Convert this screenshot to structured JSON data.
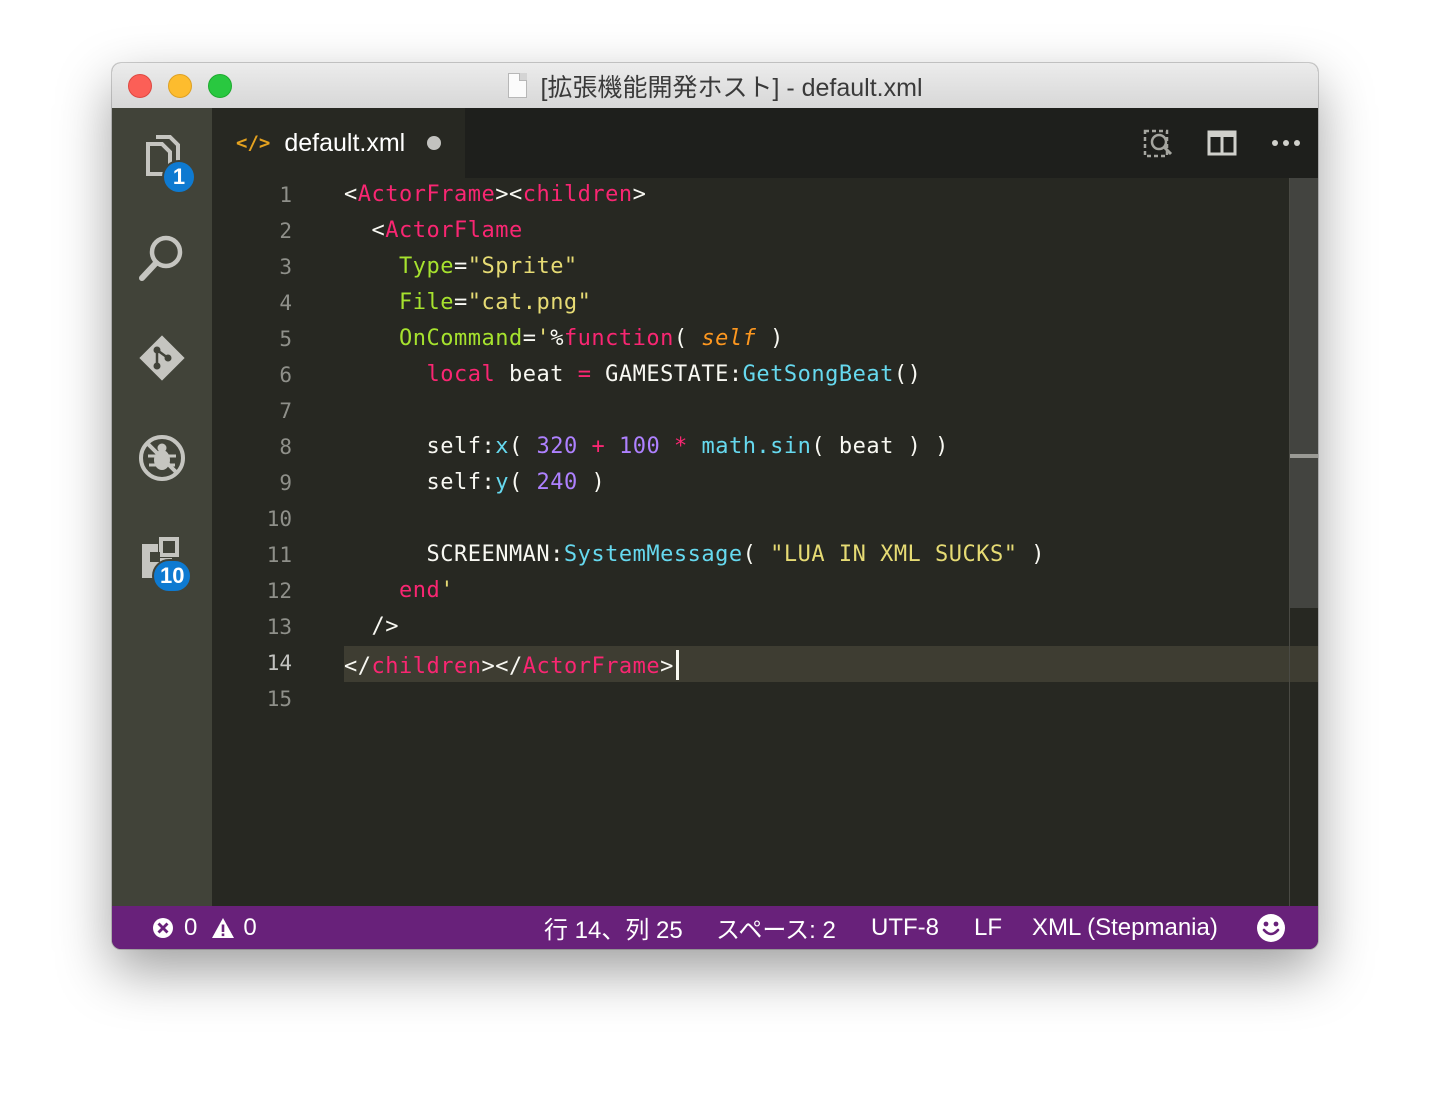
{
  "window": {
    "title": "[拡張機能開発ホスト] - default.xml"
  },
  "activity_bar": {
    "items": [
      {
        "name": "explorer-icon",
        "badge": "1"
      },
      {
        "name": "search-icon",
        "badge": ""
      },
      {
        "name": "git-icon",
        "badge": ""
      },
      {
        "name": "debug-icon",
        "badge": ""
      },
      {
        "name": "extensions-icon",
        "badge": "10"
      }
    ]
  },
  "tab": {
    "icon": "</>",
    "label": "default.xml",
    "dirty": true
  },
  "editor_actions": [
    "open-preview-icon",
    "split-editor-icon",
    "more-icon"
  ],
  "editor": {
    "line_numbers": [
      "1",
      "2",
      "3",
      "4",
      "5",
      "6",
      "7",
      "8",
      "9",
      "10",
      "11",
      "12",
      "13",
      "14",
      "15"
    ],
    "current_line": 14,
    "lines": [
      "<ActorFrame><children>",
      "  <ActorFlame",
      "    Type=\"Sprite\"",
      "    File=\"cat.png\"",
      "    OnCommand='%function( self )",
      "      local beat = GAMESTATE:GetSongBeat()",
      "",
      "      self:x( 320 + 100 * math.sin( beat ) )",
      "      self:y( 240 )",
      "",
      "      SCREENMAN:SystemMessage( \"LUA IN XML SUCKS\" )",
      "    end'",
      "  />",
      "</children></ActorFrame>",
      ""
    ]
  },
  "theme": {
    "tag": "#f92672",
    "attribute": "#a6e22e",
    "string": "#e6db74",
    "keyword": "#f92672",
    "function": "#66d9ef",
    "number": "#ae81ff",
    "self": "#fd971f",
    "text": "#f8f8f2"
  },
  "status_bar": {
    "errors": "0",
    "warnings": "0",
    "position": "行 14、列 25",
    "indent": "スペース: 2",
    "encoding": "UTF-8",
    "eol": "LF",
    "language": "XML (Stepmania)",
    "feedback_icon": "smiley-icon"
  }
}
